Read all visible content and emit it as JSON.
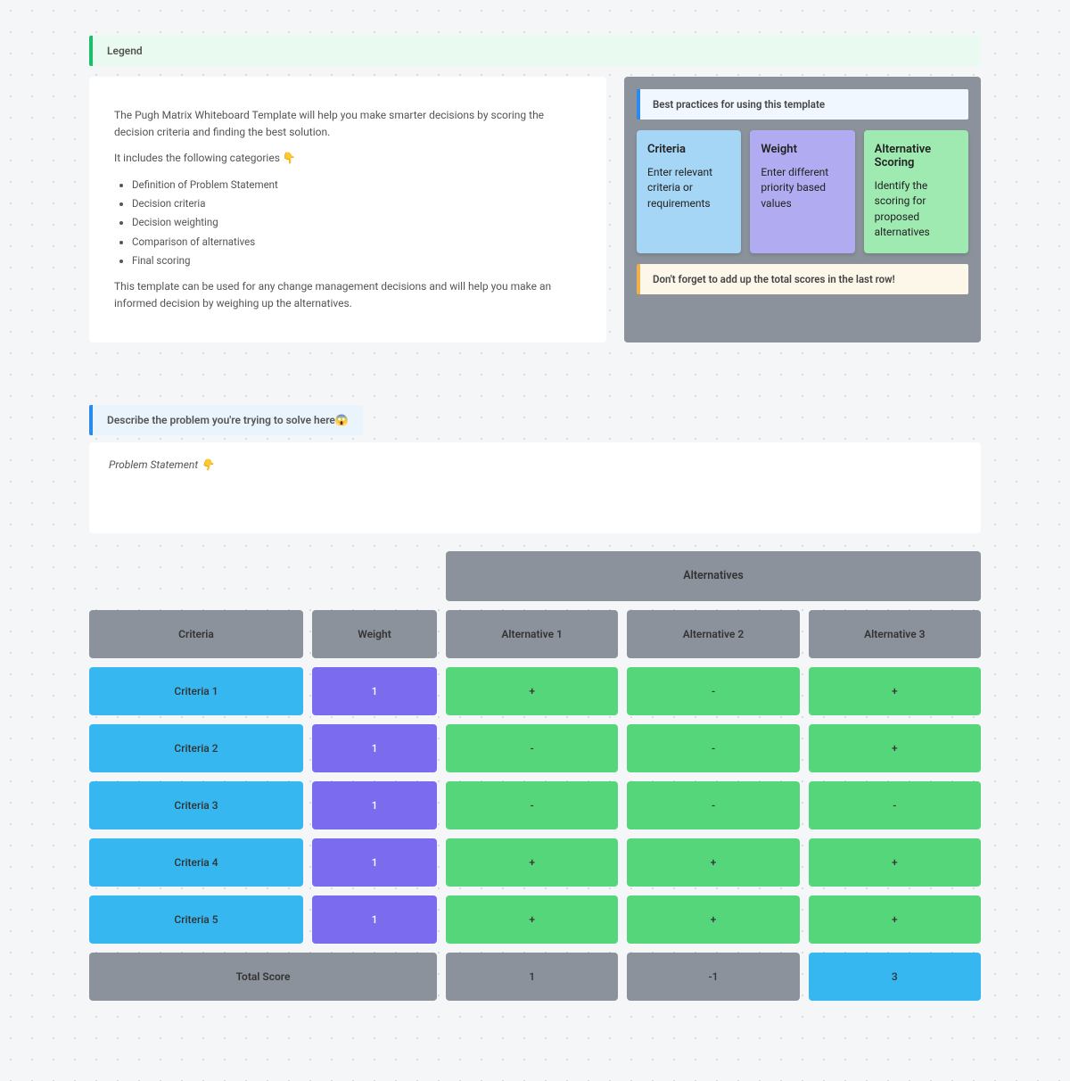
{
  "legend": {
    "title": "Legend",
    "intro1": "The Pugh Matrix Whiteboard Template will help you make smarter decisions by scoring the decision criteria and finding the best solution.",
    "intro2": "It includes the following categories 👇",
    "categories": [
      "Definition of Problem Statement",
      "Decision criteria",
      "Decision weighting",
      "Comparison of alternatives",
      "Final scoring"
    ],
    "outro": "This template can be used for any change management decisions and will help you make an informed decision by weighing up the alternatives.",
    "best_practices": "Best practices for using this template",
    "stickies": [
      {
        "title": "Criteria",
        "body": "Enter relevant criteria or requirements"
      },
      {
        "title": "Weight",
        "body": "Enter different priority based values"
      },
      {
        "title": "Alternative Scoring",
        "body": "Identify the scoring for proposed alternatives"
      }
    ],
    "reminder": "Don't forget to add up the total scores in the last row!"
  },
  "problem": {
    "title": "Describe the problem you're trying to solve here😱",
    "placeholder": "Problem Statement 👇"
  },
  "matrix": {
    "alt_header": "Alternatives",
    "headers": {
      "criteria": "Criteria",
      "weight": "Weight",
      "alt1": "Alternative 1",
      "alt2": "Alternative 2",
      "alt3": "Alternative 3"
    },
    "rows": [
      {
        "criteria": "Criteria 1",
        "weight": "1",
        "alt1": "+",
        "alt2": "-",
        "alt3": "+"
      },
      {
        "criteria": "Criteria 2",
        "weight": "1",
        "alt1": "-",
        "alt2": "-",
        "alt3": "+"
      },
      {
        "criteria": "Criteria 3",
        "weight": "1",
        "alt1": "-",
        "alt2": "-",
        "alt3": "-"
      },
      {
        "criteria": "Criteria 4",
        "weight": "1",
        "alt1": "+",
        "alt2": "+",
        "alt3": "+"
      },
      {
        "criteria": "Criteria 5",
        "weight": "1",
        "alt1": "+",
        "alt2": "+",
        "alt3": "+"
      }
    ],
    "total": {
      "label": "Total Score",
      "alt1": "1",
      "alt2": "-1",
      "alt3": "3"
    }
  }
}
